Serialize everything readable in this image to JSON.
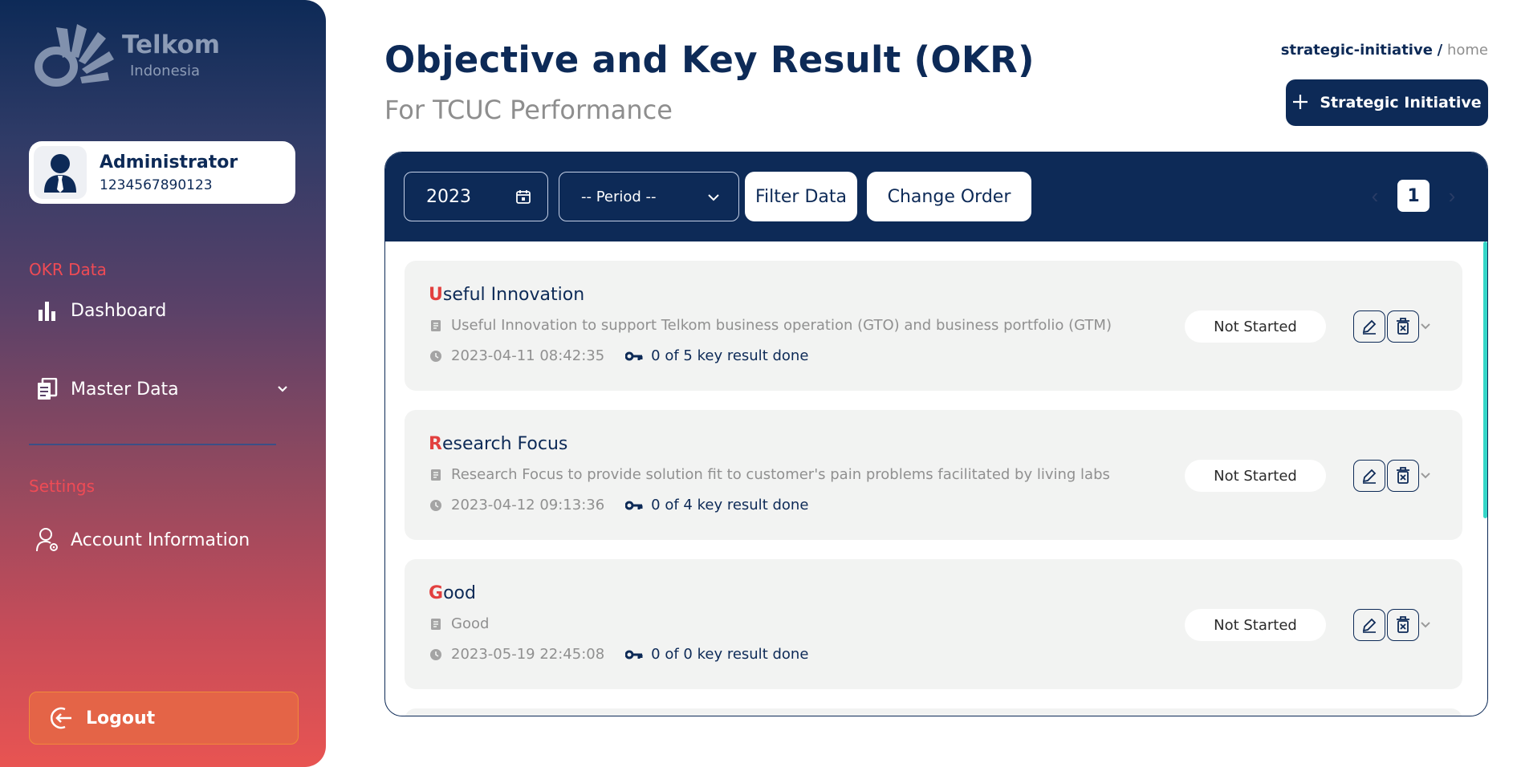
{
  "brand": {
    "name": "Telkom",
    "sub": "Indonesia"
  },
  "user": {
    "name": "Administrator",
    "id": "1234567890123"
  },
  "sidebar": {
    "section_okr": "OKR Data",
    "items": [
      {
        "label": "Dashboard",
        "icon": "bar-chart-icon"
      },
      {
        "label": "Master Data",
        "icon": "documents-icon"
      }
    ],
    "section_settings": "Settings",
    "account_label": "Account Information",
    "logout_label": "Logout"
  },
  "header": {
    "title": "Objective and Key Result (OKR)",
    "subtitle": "For TCUC Performance",
    "breadcrumb_current": "strategic-initiative",
    "breadcrumb_sep": "/",
    "breadcrumb_home": "home",
    "add_button": "Strategic Initiative"
  },
  "toolbar": {
    "year": "2023",
    "period_placeholder": "-- Period --",
    "filter_label": "Filter Data",
    "order_label": "Change Order",
    "page": "1",
    "prev": "‹",
    "next": "›"
  },
  "items": [
    {
      "title_first": "U",
      "title_rest": "seful Innovation",
      "description": "Useful Innovation to support Telkom business operation (GTO) and business portfolio (GTM)",
      "timestamp": "2023-04-11 08:42:35",
      "key_results": "0 of 5 key result done",
      "status": "Not Started"
    },
    {
      "title_first": "R",
      "title_rest": "esearch Focus",
      "description": "Research Focus to provide solution fit to customer's pain problems facilitated by living labs",
      "timestamp": "2023-04-12 09:13:36",
      "key_results": "0 of 4 key result done",
      "status": "Not Started"
    },
    {
      "title_first": "G",
      "title_rest": "ood",
      "description": "Good",
      "timestamp": "2023-05-19 22:45:08",
      "key_results": "0 of 0 key result done",
      "status": "Not Started"
    }
  ],
  "colors": {
    "navy": "#0d2a57",
    "accent_red": "#e2403f",
    "scroll": "#35d6c8"
  }
}
